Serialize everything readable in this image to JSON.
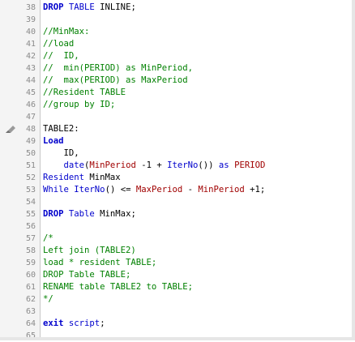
{
  "editor": {
    "lines": [
      {
        "num": "38",
        "tokens": [
          {
            "t": "DROP",
            "c": "kw"
          },
          {
            "t": " ",
            "c": "id"
          },
          {
            "t": "TABLE",
            "c": "kwn"
          },
          {
            "t": " INLINE;",
            "c": "id"
          }
        ]
      },
      {
        "num": "39",
        "tokens": []
      },
      {
        "num": "40",
        "tokens": [
          {
            "t": "//MinMax:",
            "c": "cm"
          }
        ]
      },
      {
        "num": "41",
        "tokens": [
          {
            "t": "//load",
            "c": "cm"
          }
        ]
      },
      {
        "num": "42",
        "tokens": [
          {
            "t": "//  ID,",
            "c": "cm"
          }
        ]
      },
      {
        "num": "43",
        "tokens": [
          {
            "t": "//  min(PERIOD) as MinPeriod,",
            "c": "cm"
          }
        ]
      },
      {
        "num": "44",
        "tokens": [
          {
            "t": "//  max(PERIOD) as MaxPeriod",
            "c": "cm"
          }
        ]
      },
      {
        "num": "45",
        "tokens": [
          {
            "t": "//Resident TABLE",
            "c": "cm"
          }
        ]
      },
      {
        "num": "46",
        "tokens": [
          {
            "t": "//group by ID;",
            "c": "cm"
          }
        ]
      },
      {
        "num": "47",
        "tokens": []
      },
      {
        "num": "48",
        "marker": true,
        "tokens": [
          {
            "t": "TABLE2:",
            "c": "id"
          }
        ]
      },
      {
        "num": "49",
        "tokens": [
          {
            "t": "Load",
            "c": "kw"
          }
        ]
      },
      {
        "num": "50",
        "tokens": [
          {
            "t": "    ID,",
            "c": "id"
          }
        ]
      },
      {
        "num": "51",
        "tokens": [
          {
            "t": "    ",
            "c": "id"
          },
          {
            "t": "date",
            "c": "fn"
          },
          {
            "t": "(",
            "c": "id"
          },
          {
            "t": "MinPeriod",
            "c": "red"
          },
          {
            "t": " -1 + ",
            "c": "id"
          },
          {
            "t": "IterNo",
            "c": "fn"
          },
          {
            "t": "()) ",
            "c": "id"
          },
          {
            "t": "as",
            "c": "kwn"
          },
          {
            "t": " ",
            "c": "id"
          },
          {
            "t": "PERIOD",
            "c": "red"
          }
        ]
      },
      {
        "num": "52",
        "tokens": [
          {
            "t": "Resident",
            "c": "kwn"
          },
          {
            "t": " MinMax",
            "c": "id"
          }
        ]
      },
      {
        "num": "53",
        "tokens": [
          {
            "t": "While",
            "c": "kwn"
          },
          {
            "t": " ",
            "c": "id"
          },
          {
            "t": "IterNo",
            "c": "fn"
          },
          {
            "t": "() <= ",
            "c": "id"
          },
          {
            "t": "MaxPeriod",
            "c": "red"
          },
          {
            "t": " - ",
            "c": "id"
          },
          {
            "t": "MinPeriod",
            "c": "red"
          },
          {
            "t": " +1;",
            "c": "id"
          }
        ]
      },
      {
        "num": "54",
        "tokens": []
      },
      {
        "num": "55",
        "tokens": [
          {
            "t": "DROP",
            "c": "kw"
          },
          {
            "t": " ",
            "c": "id"
          },
          {
            "t": "Table",
            "c": "kwn"
          },
          {
            "t": " MinMax;",
            "c": "id"
          }
        ]
      },
      {
        "num": "56",
        "tokens": []
      },
      {
        "num": "57",
        "tokens": [
          {
            "t": "/*",
            "c": "cm"
          }
        ]
      },
      {
        "num": "58",
        "tokens": [
          {
            "t": "Left join (TABLE2)",
            "c": "cm"
          }
        ]
      },
      {
        "num": "59",
        "tokens": [
          {
            "t": "load * resident TABLE;",
            "c": "cm"
          }
        ]
      },
      {
        "num": "60",
        "tokens": [
          {
            "t": "DROP Table TABLE;",
            "c": "cm"
          }
        ]
      },
      {
        "num": "61",
        "tokens": [
          {
            "t": "RENAME table TABLE2 to TABLE;",
            "c": "cm"
          }
        ]
      },
      {
        "num": "62",
        "tokens": [
          {
            "t": "*/",
            "c": "cm"
          }
        ]
      },
      {
        "num": "63",
        "tokens": []
      },
      {
        "num": "64",
        "tokens": [
          {
            "t": "exit",
            "c": "kw"
          },
          {
            "t": " ",
            "c": "id"
          },
          {
            "t": "script",
            "c": "kwn"
          },
          {
            "t": ";",
            "c": "id"
          }
        ]
      },
      {
        "num": "65",
        "tokens": []
      }
    ]
  }
}
